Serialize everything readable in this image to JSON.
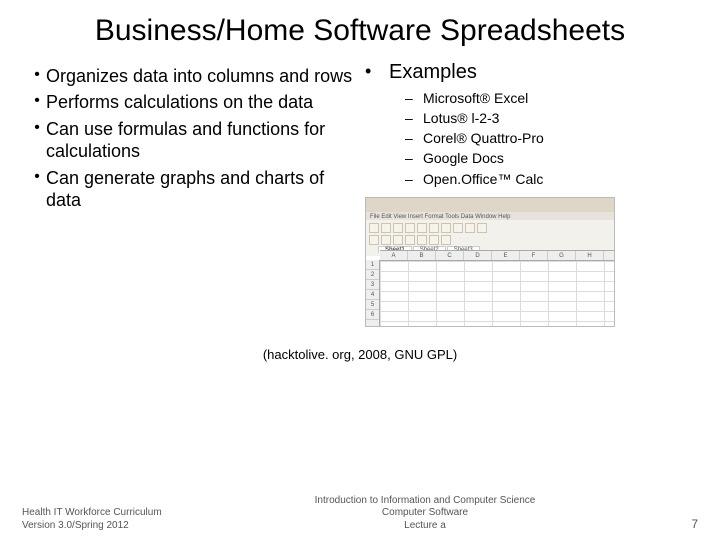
{
  "title": "Business/Home Software Spreadsheets",
  "left_bullets": [
    "Organizes data into columns and rows",
    "Performs calculations on the data",
    "Can use formulas and functions for calculations",
    "Can generate graphs and charts of data"
  ],
  "right_heading": "Examples",
  "examples": [
    "Microsoft® Excel",
    "Lotus® l-2-3",
    "Corel® Quattro-Pro",
    "Google Docs",
    "Open.Office™ Calc"
  ],
  "thumb": {
    "menu": "File Edit View Insert Format Tools Data Window Help",
    "tabs": [
      "Sheet1",
      "Sheet2",
      "Sheet3"
    ],
    "cols": [
      "A",
      "B",
      "C",
      "D",
      "E",
      "F",
      "G",
      "H"
    ],
    "rows": [
      "1",
      "2",
      "3",
      "4",
      "5",
      "6"
    ]
  },
  "caption": "(hacktolive. org, 2008, GNU GPL)",
  "footer": {
    "left_line1": "Health IT Workforce Curriculum",
    "left_line2": "Version 3.0/Spring 2012",
    "center_line1": "Introduction to Information and Computer Science",
    "center_line2": "Computer Software",
    "center_line3": "Lecture a",
    "page": "7"
  }
}
